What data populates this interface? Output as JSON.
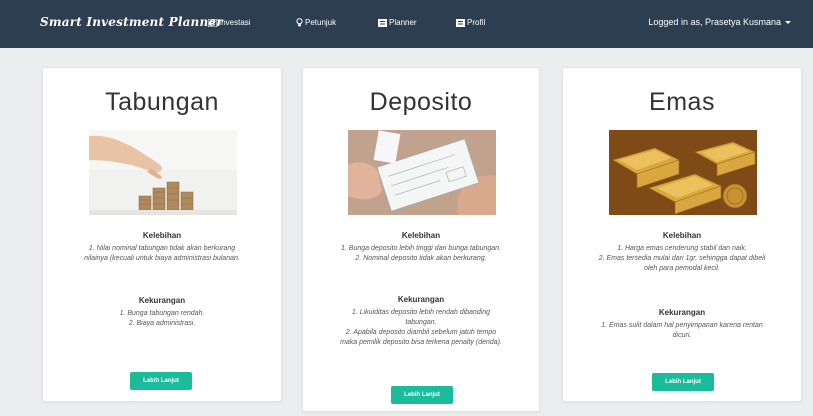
{
  "navbar": {
    "brand": "Smart Investment Planner",
    "items": [
      {
        "label": "Investasi",
        "icon": "list-icon"
      },
      {
        "label": "Petunjuk",
        "icon": "lightbulb-icon"
      },
      {
        "label": "Planner",
        "icon": "list-icon"
      },
      {
        "label": "Profil",
        "icon": "list-icon"
      }
    ],
    "user": "Logged in as, Prasetya Kusmana"
  },
  "cards": [
    {
      "title": "Tabungan",
      "kelebihan_head": "Kelebihan",
      "kelebihan_lines": [
        "1. Nilai nominal tabungan tidak akan berkurang",
        "nilainya (kecuali untuk biaya administrasi bulanan."
      ],
      "kekurangan_head": "Kekurangan",
      "kekurangan_lines": [
        "1. Bunga tabungan rendah.",
        "2. Biaya administrasi."
      ],
      "button": "Lebih Lanjut"
    },
    {
      "title": "Deposito",
      "kelebihan_head": "Kelebihan",
      "kelebihan_lines": [
        "1. Bunga deposito lebih tinggi dari bunga tabungan.",
        "2. Nominal deposito tidak akan berkurang."
      ],
      "kekurangan_head": "Kekurangan",
      "kekurangan_lines": [
        "1. Likuiditas deposito lebih rendah dibanding",
        "tabungan.",
        "2. Apabila deposito diambil sebelum jatuh tempo",
        "maka pemilik deposito bisa terkena penalty (denda)."
      ],
      "button": "Lebih Lanjut"
    },
    {
      "title": "Emas",
      "kelebihan_head": "Kelebihan",
      "kelebihan_lines": [
        "1. Harga emas cenderung stabil dan naik.",
        "2. Emas tersedia mulai dari 1gr, sehingga dapat dibeli",
        "oleh para pemodal kecil."
      ],
      "kekurangan_head": "Kekurangan",
      "kekurangan_lines": [
        "1. Emas sulit dalam hal penyimpanan karena rentan",
        "dicuri."
      ],
      "button": "Lebih Lanjut"
    }
  ],
  "colors": {
    "navbar_bg": "#2c3e50",
    "accent": "#1abc9c",
    "page_bg": "#ecedee"
  }
}
